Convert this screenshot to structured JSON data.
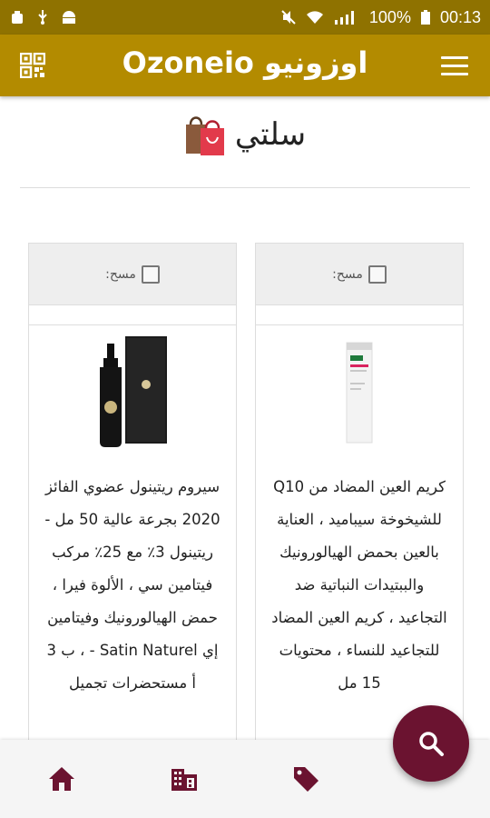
{
  "status_bar": {
    "battery_percent": "100%",
    "time": "00:13"
  },
  "app_bar": {
    "title": "Ozoneio اوزونيو"
  },
  "page": {
    "title": "سلتي"
  },
  "cart_items": [
    {
      "remove_label": ":مسح",
      "description": "سيروم ريتينول عضوي الفائز 2020 بجرعة عالية 50 مل - ريتينول 3٪ مع 25٪ مركب فيتامين سي ، الألوة فيرا ، حمض الهيالورونيك وفيتامين إي Satin Naturel - ، ب 3 أ مستحضرات تجميل"
    },
    {
      "remove_label": ":مسح",
      "description": "كريم العين المضاد من Q10 للشيخوخة سيباميد ، العناية بالعين بحمض الهيالورونيك والببتيدات النباتية ضد التجاعيد ، كريم العين المضاد للتجاعيد للنساء ، محتويات 15 مل"
    }
  ],
  "colors": {
    "app_bar": "#b38b00",
    "status_bar": "#8f7200",
    "accent": "#6b1330"
  },
  "icons": [
    "qr-code-icon",
    "menu-icon",
    "shopping-bag-icon",
    "home-icon",
    "building-icon",
    "tag-icon",
    "search-icon"
  ]
}
